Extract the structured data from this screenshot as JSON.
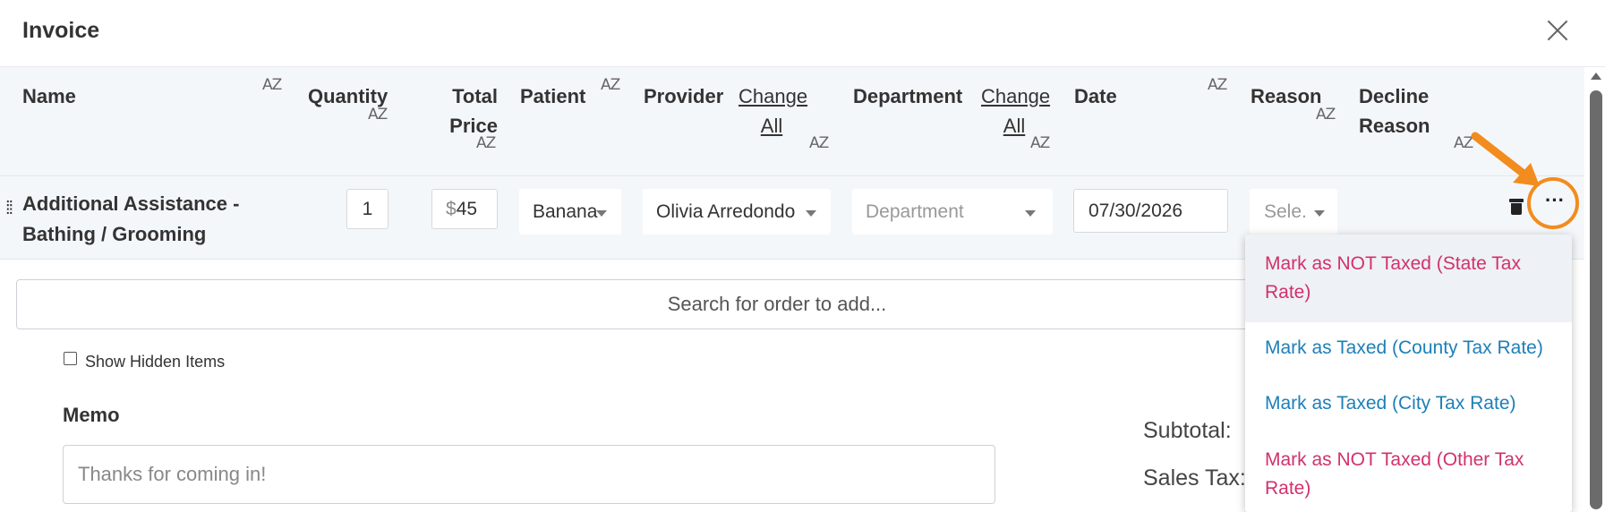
{
  "modal": {
    "title": "Invoice"
  },
  "columns": {
    "name": "Name",
    "quantity": "Quantity",
    "total_price": [
      "Total",
      "Price"
    ],
    "patient": "Patient",
    "provider": "Provider",
    "provider_change_all": [
      "Change",
      "All"
    ],
    "department": "Department",
    "department_change_all": [
      "Change",
      "All"
    ],
    "date": "Date",
    "reason": "Reason",
    "decline_reason": [
      "Decline",
      "Reason"
    ],
    "sort_glyph": "AZ"
  },
  "row": {
    "name": [
      "Additional Assistance -",
      "Bathing / Grooming"
    ],
    "quantity": "1",
    "currency": "$",
    "price": "45",
    "patient": "Banana",
    "provider": "Olivia Arredondo",
    "department_placeholder": "Department",
    "date": "07/30/2026",
    "reason_placeholder": "Sele."
  },
  "search": {
    "placeholder": "Search for order to add..."
  },
  "show_hidden": {
    "label": "Show Hidden Items",
    "checked": false
  },
  "memo": {
    "label": "Memo",
    "placeholder": "Thanks for coming in!"
  },
  "totals": {
    "subtotal_label": "Subtotal:",
    "sales_tax_label": "Sales Tax:"
  },
  "menu": {
    "items": [
      {
        "lines": [
          "Mark as NOT Taxed (State Tax",
          "Rate)"
        ],
        "color": "#d1316c"
      },
      {
        "lines": [
          "Mark as Taxed (County Tax Rate)"
        ],
        "color": "#1d7fb8"
      },
      {
        "lines": [
          "Mark as Taxed (City Tax Rate)"
        ],
        "color": "#1d7fb8"
      },
      {
        "lines": [
          "Mark as NOT Taxed (Other Tax",
          "Rate)"
        ],
        "color": "#d1316c"
      }
    ]
  },
  "icons": [
    "close-icon",
    "sort-icon",
    "drag-handle-icon",
    "trash-icon",
    "more-options-icon",
    "chevron-down-icon",
    "annotation-arrow"
  ],
  "colors": {
    "highlight": "#f28c1e",
    "header_bg": "#f4f7fa"
  }
}
